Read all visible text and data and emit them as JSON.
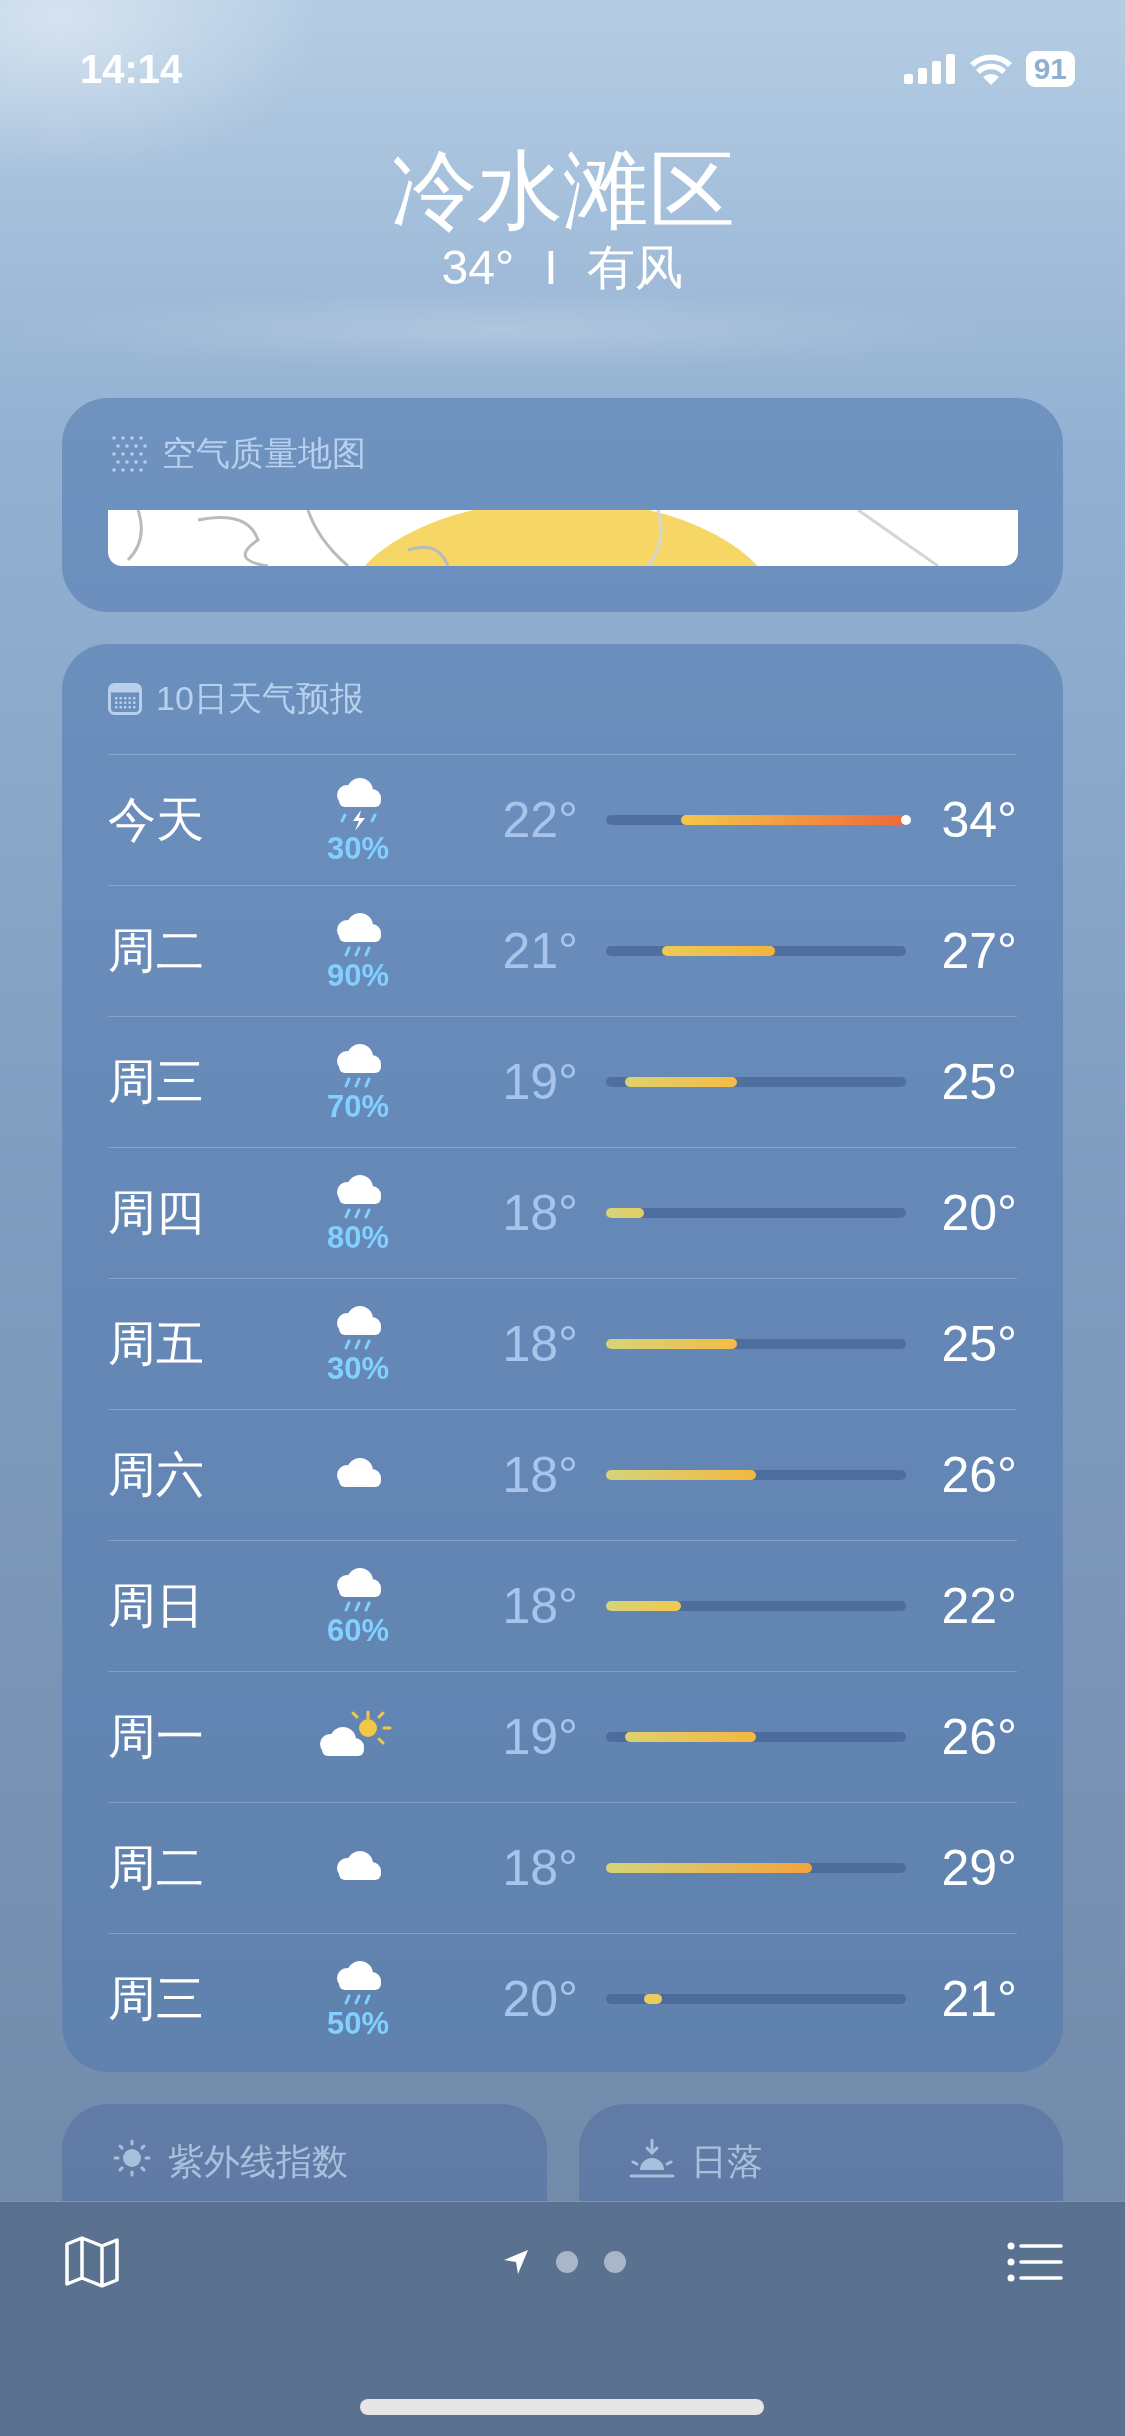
{
  "status_bar": {
    "time": "14:14",
    "battery": "91"
  },
  "location": {
    "title": "冷水滩区",
    "temperature": "34°",
    "separator": "I",
    "condition": "有风"
  },
  "air_quality": {
    "title": "空气质量地图"
  },
  "forecast": {
    "title": "10日天气预报",
    "days": [
      {
        "day": "今天",
        "kind": "thunderstorm",
        "precip": "30%",
        "low": "22°",
        "high": "34°",
        "now_marker": true
      },
      {
        "day": "周二",
        "kind": "rain",
        "precip": "90%",
        "low": "21°",
        "high": "27°",
        "now_marker": false
      },
      {
        "day": "周三",
        "kind": "rain",
        "precip": "70%",
        "low": "19°",
        "high": "25°",
        "now_marker": false
      },
      {
        "day": "周四",
        "kind": "rain",
        "precip": "80%",
        "low": "18°",
        "high": "20°",
        "now_marker": false
      },
      {
        "day": "周五",
        "kind": "rain",
        "precip": "30%",
        "low": "18°",
        "high": "25°",
        "now_marker": false
      },
      {
        "day": "周六",
        "kind": "cloud",
        "low": "18°",
        "high": "26°",
        "now_marker": false
      },
      {
        "day": "周日",
        "kind": "rain",
        "precip": "60%",
        "low": "18°",
        "high": "22°",
        "now_marker": false
      },
      {
        "day": "周一",
        "kind": "partly_sunny",
        "low": "19°",
        "high": "26°",
        "now_marker": false
      },
      {
        "day": "周二",
        "kind": "cloud",
        "low": "18°",
        "high": "29°",
        "now_marker": false
      },
      {
        "day": "周三",
        "kind": "rain",
        "precip": "50%",
        "low": "20°",
        "high": "21°",
        "now_marker": false
      }
    ]
  },
  "tiles": [
    {
      "kind": "uv",
      "title": "紫外线指数"
    },
    {
      "kind": "sunset",
      "title": "日落"
    }
  ],
  "toolbar": {
    "pages": [
      {
        "kind": "location",
        "selected": true
      },
      {
        "kind": "dot",
        "selected": false
      },
      {
        "kind": "dot",
        "selected": false
      }
    ]
  }
}
